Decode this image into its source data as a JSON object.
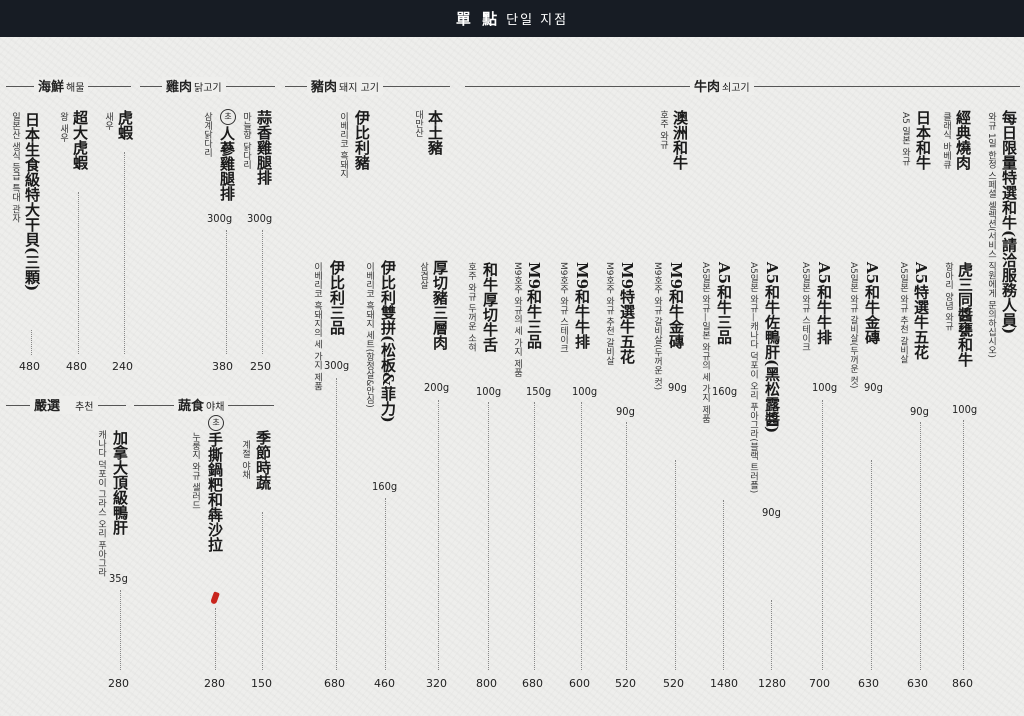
{
  "header": {
    "title_cn": "單 點",
    "title_kr": "단일 지점"
  },
  "sections": {
    "seafood": {
      "cn": "海鮮",
      "kr": "해물"
    },
    "chicken": {
      "cn": "雞肉",
      "kr": "닭고기"
    },
    "pork": {
      "cn": "豬肉",
      "kr": "돼지 고기"
    },
    "beef": {
      "cn": "牛肉",
      "kr": "쇠고기"
    },
    "selected": {
      "cn": "嚴選",
      "kr": "추천"
    },
    "vegetable": {
      "cn": "蔬食",
      "kr": "야채"
    }
  },
  "items": {
    "i1": {
      "name": "日本生食級特大干貝(三顆)",
      "sub": "일본산 생식 등급 특대 관자",
      "price": "480"
    },
    "i2": {
      "name": "超大虎蝦",
      "sub": "왕 새우",
      "price": "480"
    },
    "i3": {
      "name": "虎蝦",
      "sub": "새우",
      "price": "240"
    },
    "i4": {
      "name": "人蔘雞腿排",
      "sub": "삼계닭다리",
      "badge": "초",
      "weight": "300g",
      "price": "380"
    },
    "i5": {
      "name": "蒜香雞腿排",
      "sub": "마늘향 닭다리",
      "weight": "300g",
      "price": "250"
    },
    "i6": {
      "name": "伊比利豬",
      "sub": "이베리코 흑돼지"
    },
    "i7": {
      "name": "本土豬",
      "sub": "대만산"
    },
    "i8": {
      "name": "澳洲和牛",
      "sub": "호주 와규"
    },
    "i9": {
      "name": "日本和牛",
      "sub": "A5 일본 와규"
    },
    "i10": {
      "name": "經典燒肉",
      "sub": "클래식 바베큐"
    },
    "i11": {
      "name": "每日限量特選和牛(請洽服務人員)",
      "sub": "와규 1일 한정 스페셜 셀렉션(서비스 직원에게 문의하십시오)"
    },
    "i12": {
      "name": "伊比利三品",
      "sub": "이베리코 흑돼지의 세 가지 제품",
      "weight": "300g",
      "price": "680"
    },
    "i13": {
      "name": "伊比利雙拼(松板&菲力)",
      "sub": "이베리코 흑돼지 세트(항정살&안심)",
      "weight": "160g",
      "price": "460"
    },
    "i14": {
      "name": "厚切豬三層肉",
      "sub": "삼겹살",
      "weight": "200g",
      "price": "320"
    },
    "i15": {
      "name": "和牛厚切牛舌",
      "sub": "호주 와규 두꺼운 소혀",
      "weight": "100g",
      "price": "800"
    },
    "i16": {
      "name": "M9和牛三品",
      "sub": "M9호주 와규의 세 가지 제품",
      "weight": "150g",
      "price": "680"
    },
    "i17": {
      "name": "M9和牛牛排",
      "sub": "M9호주 와규 스테이크",
      "weight": "100g",
      "price": "600"
    },
    "i18": {
      "name": "M9特選牛五花",
      "sub": "M9호주 와규 추천 갈비살",
      "weight": "90g",
      "price": "520"
    },
    "i19": {
      "name": "M9和牛金磚",
      "sub": "M9호주 와규 갈비살(두꺼운 컷)",
      "weight": "90g",
      "price": "520"
    },
    "i20": {
      "name": "A5和牛三品",
      "sub": "A5일본 와규—일본 와규의 세 가지 제품",
      "weight": "160g",
      "price": "1480"
    },
    "i21": {
      "name": "A5和牛佐鴨肝(黑松露醬)",
      "sub": "A5일본 와규—캐나다 덕포이 오리 푸아그라(블랙 트러플)",
      "weight": "90g",
      "price": "1280"
    },
    "i22": {
      "name": "A5和牛牛排",
      "sub": "A5일본 와규 스테이크",
      "weight": "100g",
      "price": "700"
    },
    "i23": {
      "name": "A5和牛金磚",
      "sub": "A5일본 와규 갈비살(두꺼운 컷)",
      "weight": "90g",
      "price": "630"
    },
    "i24": {
      "name": "A5特選牛五花",
      "sub": "A5일본 와규 추천 갈비살",
      "weight": "90g",
      "price": "630"
    },
    "i25": {
      "name": "虎三同醬甕和牛",
      "sub": "항아리 양념 와규",
      "weight": "100g",
      "price": "860"
    },
    "i26": {
      "name": "加拿大頂級鴨肝",
      "sub": "캐나다 덕포이 그라스 오리 푸아그라",
      "weight": "35g",
      "price": "280"
    },
    "i27": {
      "name": "手撕鍋粑和犇沙拉",
      "sub": "누룽지 와규 샐러드",
      "badge": "초",
      "price": "280"
    },
    "i28": {
      "name": "季節時蔬",
      "sub": "계절 야채",
      "price": "150"
    }
  }
}
